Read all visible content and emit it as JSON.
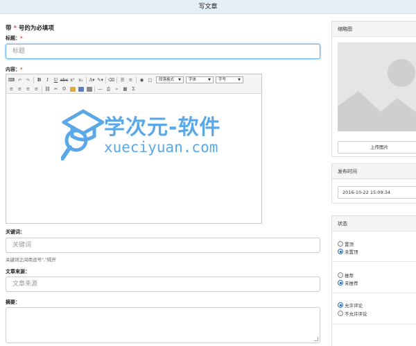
{
  "header": {
    "title": "写文章"
  },
  "form": {
    "note_prefix": "带",
    "note_star": "*",
    "note_suffix": "号的为必填项",
    "title_label": "标题：",
    "title_star": "*",
    "title_placeholder": "标题",
    "content_label": "内容：",
    "content_star": "*",
    "keywords_label": "关键词：",
    "keywords_placeholder": "关键词",
    "keywords_hint": "关键词之间用逗号\",\"隔开",
    "source_label": "文章来源：",
    "source_placeholder": "文章来源",
    "summary_label": "摘要："
  },
  "editor": {
    "paragraph_format": "段落格式",
    "font_family": "字体",
    "font_size": "字号"
  },
  "watermark": {
    "title": "学次元-软件",
    "url": "xueciyuan.com"
  },
  "sidebar": {
    "thumbnail": {
      "title": "缩略图",
      "upload_button": "上传图片"
    },
    "publish": {
      "title": "发布时间",
      "datetime": "2016-10-22 15:09:34"
    },
    "status": {
      "title": "状态",
      "top_on": "置顶",
      "top_off": "未置顶",
      "recommend_on": "推荐",
      "recommend_off": "未推荐",
      "comment_on": "允许评论",
      "comment_off": "不允许评论"
    }
  },
  "colors": {
    "accent": "#5aa8e8",
    "required": "#e0463c",
    "header_bg": "#e4eef7"
  }
}
